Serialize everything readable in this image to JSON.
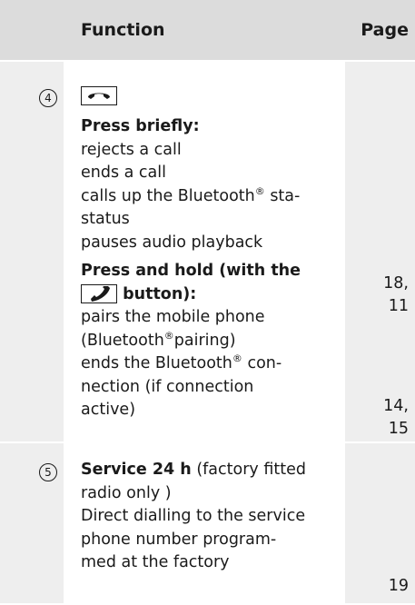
{
  "header": {
    "function": "Function",
    "page": "Page"
  },
  "row4": {
    "number": "4",
    "icon": "end-call-icon",
    "lines": [
      "Press briefly:",
      "rejects a call",
      "ends a call",
      "calls up the Bluetooth",
      "status",
      "pauses audio playback",
      "Press and hold (with the",
      "button):",
      "pairs the mobile phone",
      "(Bluetooth",
      "pairing)",
      "ends the Bluetooth",
      "con-",
      "nection (if connection",
      "active)"
    ],
    "reg": "®",
    "suffix_sta": " sta-",
    "suffix_con": " con-",
    "inline_icon": "call-icon",
    "pages": [
      "18,",
      "11",
      "14,",
      "15"
    ]
  },
  "row5": {
    "number": "5",
    "title": "Service 24 h",
    "title_rest": " (factory fitted",
    "lines": [
      "radio only )",
      "Direct dialling to the service",
      "phone number program-",
      "med at the factory"
    ],
    "page": "19"
  }
}
